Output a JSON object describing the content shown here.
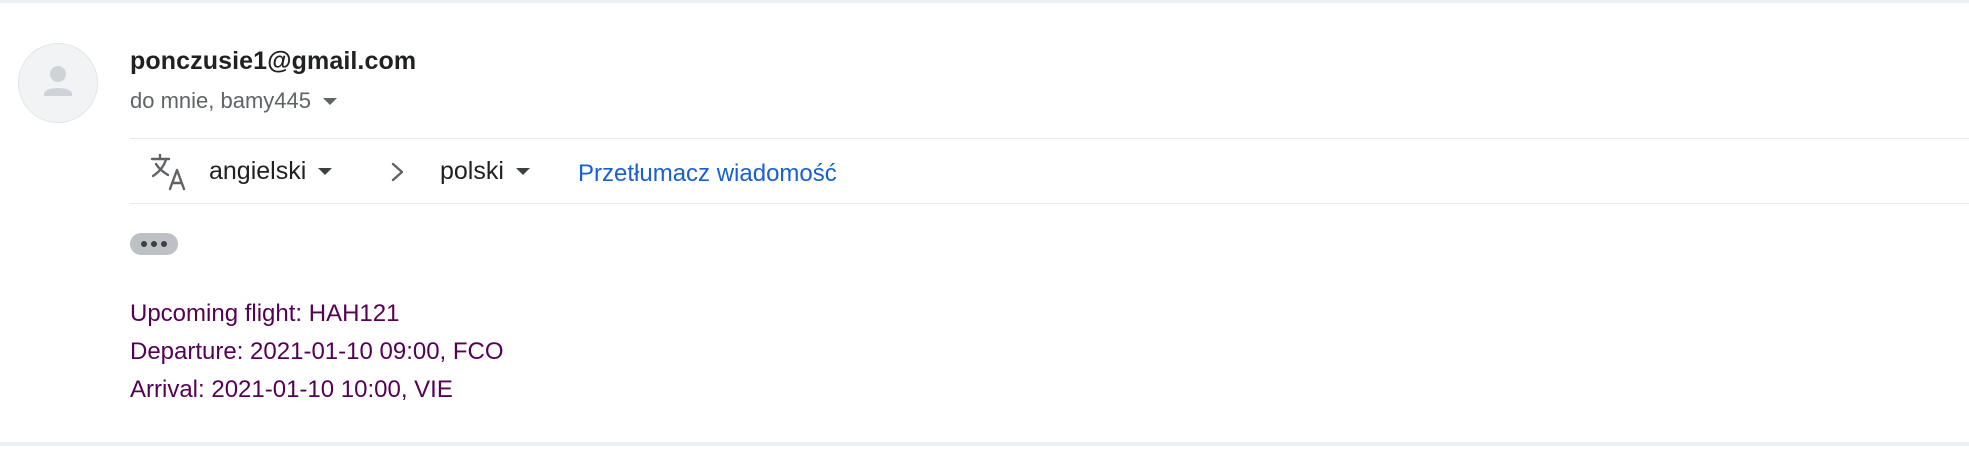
{
  "message": {
    "sender": "ponczusie1@gmail.com",
    "recipients": "do mnie, bamy445",
    "avatar_icon": "person-icon"
  },
  "translate_bar": {
    "icon": "translate-icon",
    "source_language": "angielski",
    "target_language": "polski",
    "translate_link": "Przetłumacz wiadomość",
    "link_color": "#1a5fd0"
  },
  "body": {
    "show_trimmed_icon": "ellipsis-icon",
    "color": "#550055",
    "lines": [
      "Upcoming flight: HAH121",
      "Departure: 2021-01-10 09:00, FCO",
      "Arrival: 2021-01-10 10:00, VIE"
    ]
  }
}
